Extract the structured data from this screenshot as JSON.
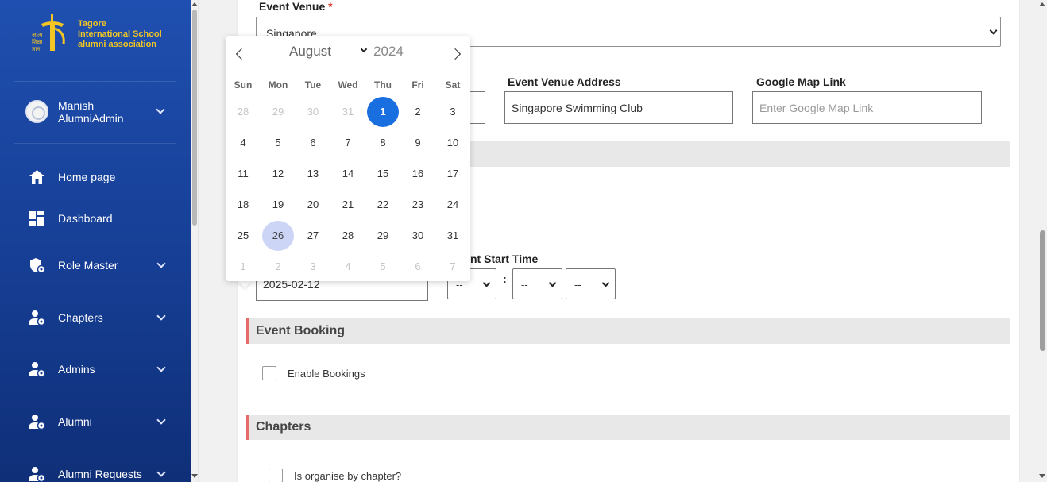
{
  "sidebar": {
    "logo_text": [
      "Tagore",
      "International School",
      "alumni association"
    ],
    "user": {
      "name_line1": "Manish",
      "name_line2": "AlumniAdmin"
    },
    "items": [
      {
        "label": "Home page",
        "icon": "home-icon",
        "has_submenu": false
      },
      {
        "label": "Dashboard",
        "icon": "dashboard-icon",
        "has_submenu": false
      },
      {
        "label": "Role Master",
        "icon": "role-icon",
        "has_submenu": true
      },
      {
        "label": "Chapters",
        "icon": "user-gear-icon",
        "has_submenu": true
      },
      {
        "label": "Admins",
        "icon": "user-gear-icon",
        "has_submenu": true
      },
      {
        "label": "Alumni",
        "icon": "user-gear-icon",
        "has_submenu": true
      },
      {
        "label": "Alumni Requests",
        "icon": "user-gear-icon",
        "has_submenu": true
      }
    ]
  },
  "form": {
    "venue": {
      "label": "Event Venue",
      "required_mark": "*",
      "value": "Singapore"
    },
    "venue_address": {
      "label": "Event Venue Address",
      "value": "Singapore Swimming Club"
    },
    "map_link": {
      "label": "Google Map Link",
      "placeholder": "Enter Google Map Link"
    },
    "start_date": {
      "value": "2025-02-12"
    },
    "start_time": {
      "label_visible": "nt Start Time",
      "hour": "--",
      "minute": "--",
      "ampm": "--",
      "separator": ":"
    },
    "booking_section": {
      "title": "Event Booking",
      "checkbox_label": "Enable Bookings"
    },
    "chapters_section": {
      "title": "Chapters",
      "checkbox_label": "Is organise by chapter?"
    }
  },
  "datepicker": {
    "month": "August",
    "year": "2024",
    "weekdays": [
      "Sun",
      "Mon",
      "Tue",
      "Wed",
      "Thu",
      "Fri",
      "Sat"
    ],
    "weeks": [
      [
        "28",
        "29",
        "30",
        "31",
        "1",
        "2",
        "3"
      ],
      [
        "4",
        "5",
        "6",
        "7",
        "8",
        "9",
        "10"
      ],
      [
        "11",
        "12",
        "13",
        "14",
        "15",
        "16",
        "17"
      ],
      [
        "18",
        "19",
        "20",
        "21",
        "22",
        "23",
        "24"
      ],
      [
        "25",
        "26",
        "27",
        "28",
        "29",
        "30",
        "31"
      ],
      [
        "1",
        "2",
        "3",
        "4",
        "5",
        "6",
        "7"
      ]
    ],
    "today_day": "1",
    "selected_day": "26",
    "colors": {
      "today": "#1a6fe0",
      "selected": "#ccd5f5"
    }
  },
  "colors": {
    "sidebar_top": "#1f4fb0",
    "sidebar_bottom": "#0f2f78",
    "logo": "#f3c623",
    "section_accent": "#e56a6a"
  }
}
